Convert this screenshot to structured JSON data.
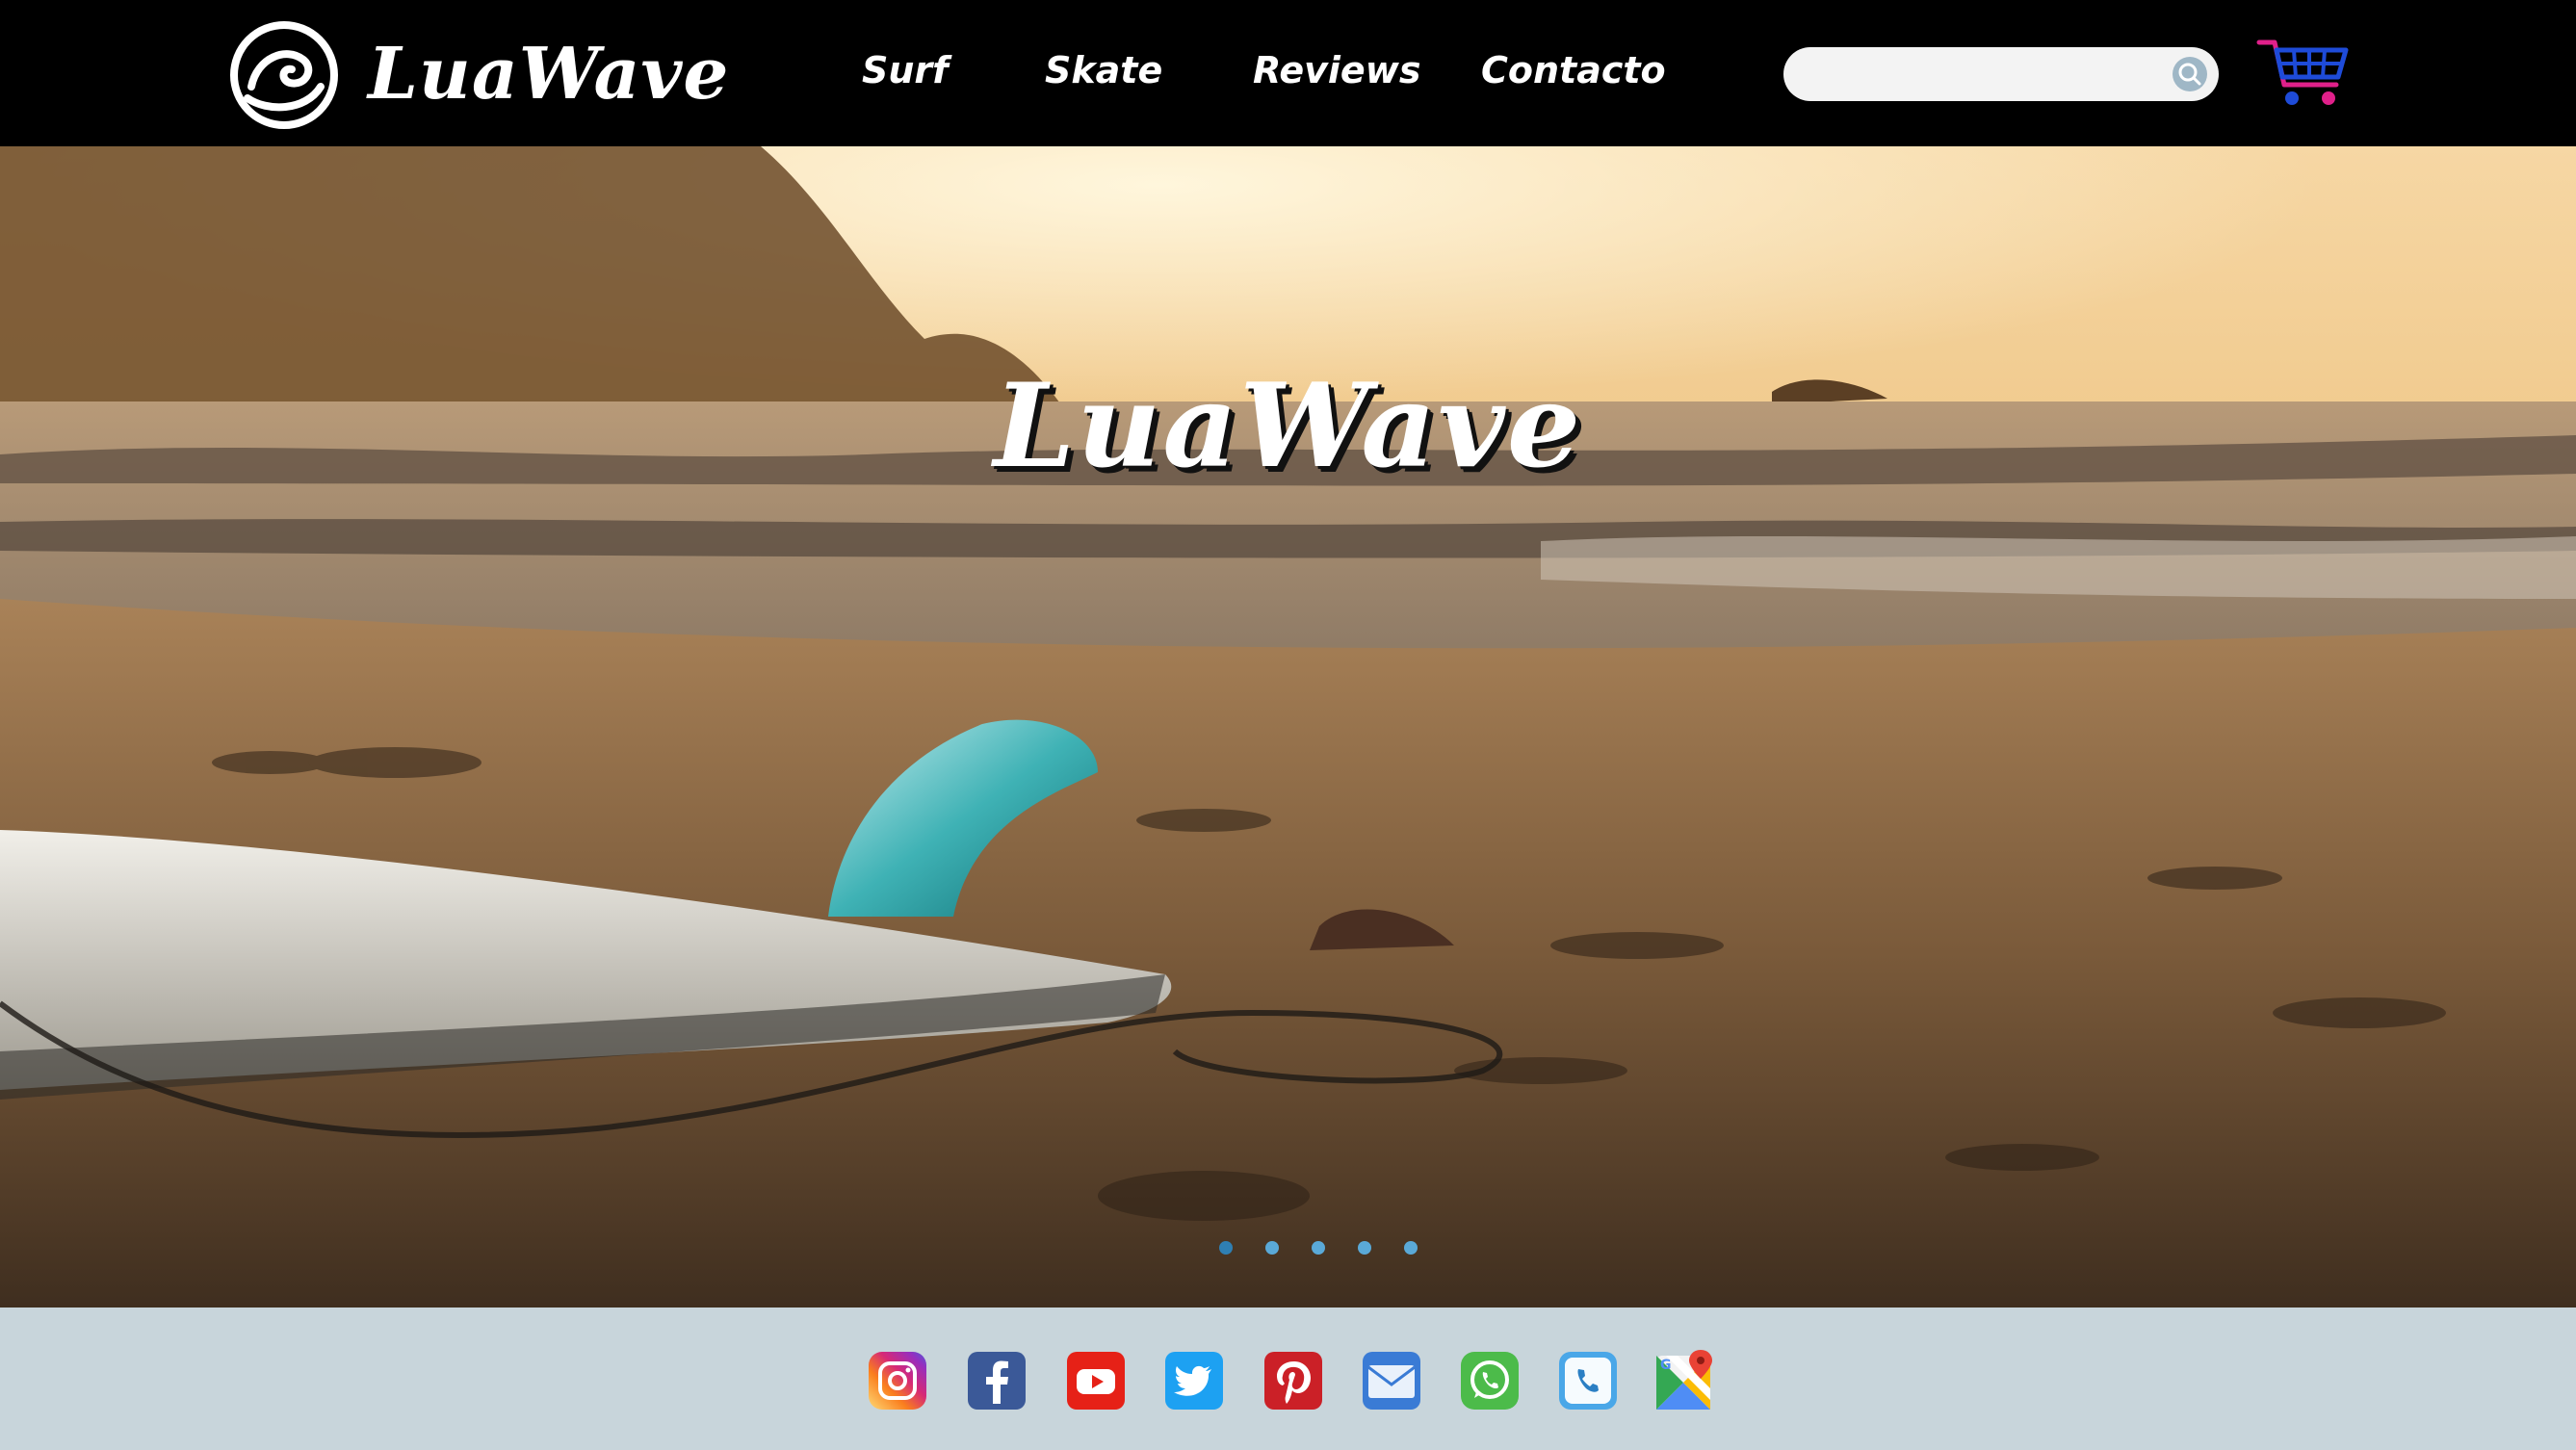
{
  "brand": {
    "name": "LuaWave"
  },
  "nav": {
    "items": [
      {
        "label": "Surf"
      },
      {
        "label": "Skate"
      },
      {
        "label": "Reviews"
      },
      {
        "label": "Contacto"
      }
    ]
  },
  "search": {
    "placeholder": "",
    "value": "",
    "icon": "search-icon"
  },
  "cart": {
    "icon": "shopping-cart-icon"
  },
  "hero": {
    "title": "LuaWave",
    "slides_total": 5,
    "active_slide": 1
  },
  "footer": {
    "social": [
      {
        "name": "instagram",
        "icon": "instagram-icon"
      },
      {
        "name": "facebook",
        "icon": "facebook-icon"
      },
      {
        "name": "youtube",
        "icon": "youtube-icon"
      },
      {
        "name": "twitter",
        "icon": "twitter-icon"
      },
      {
        "name": "pinterest",
        "icon": "pinterest-icon"
      },
      {
        "name": "email",
        "icon": "email-icon"
      },
      {
        "name": "whatsapp",
        "icon": "whatsapp-icon"
      },
      {
        "name": "phone",
        "icon": "phone-icon"
      },
      {
        "name": "google-maps",
        "icon": "google-maps-icon"
      }
    ]
  },
  "colors": {
    "header_bg": "#000000",
    "footer_bg": "#c8d5db",
    "slider_dot": "#5aa9d8",
    "cart_accent": "#1e4bd8"
  }
}
